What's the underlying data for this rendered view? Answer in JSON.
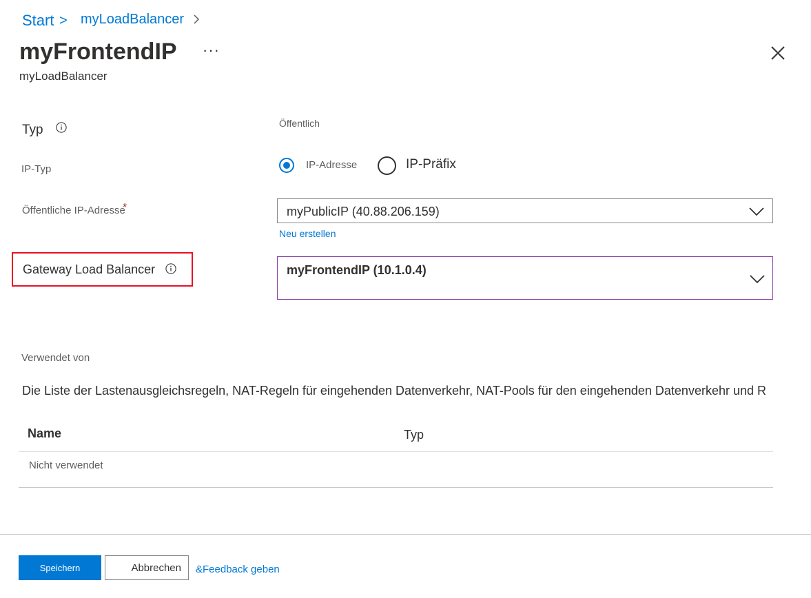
{
  "breadcrumb": {
    "start": "Start",
    "separator": ">",
    "parent": "myLoadBalancer",
    "chevron": "chevron-right-icon"
  },
  "header": {
    "title": "myFrontendIP",
    "subtitle": "myLoadBalancer",
    "more_label": "···",
    "close_icon": "close-icon"
  },
  "form": {
    "typ": {
      "label": "Typ",
      "value": "Öffentlich"
    },
    "ip_typ": {
      "label": "IP-Typ",
      "options": [
        {
          "label": "IP-Adresse",
          "selected": true
        },
        {
          "label": "IP-Präfix",
          "selected": false
        }
      ]
    },
    "public_ip": {
      "label": "Öffentliche IP-Adresse",
      "required_mark": "*",
      "value": "myPublicIP (40.88.206.159)",
      "create_link": "Neu erstellen"
    },
    "gateway_lb": {
      "label": "Gateway Load Balancer",
      "value": "myFrontendIP (10.1.0.4)"
    }
  },
  "used_by": {
    "label": "Verwendet von",
    "description": "Die Liste der Lastenausgleichsregeln, NAT-Regeln für eingehenden Datenverkehr, NAT-Pools für den eingehenden Datenverkehr und R",
    "columns": [
      "Name",
      "Typ"
    ],
    "empty_row": "Nicht verwendet"
  },
  "footer": {
    "save_label": "Speichern",
    "cancel_label": "Abbrechen",
    "feedback_label": "&Feedback geben"
  },
  "colors": {
    "accent": "#0078d4",
    "highlight": "#e81123",
    "focus_border": "#8a3ea8"
  }
}
